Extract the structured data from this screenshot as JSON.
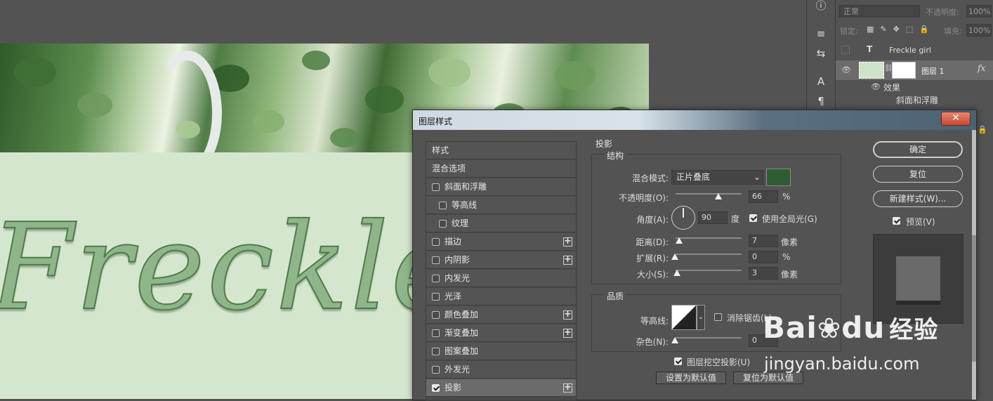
{
  "layers_panel": {
    "blend_mode": "正常",
    "opacity_label": "不透明度:",
    "opacity_value": "100%",
    "lock_label": "锁定:",
    "fill_label": "填充:",
    "fill_value": "100%",
    "layers": [
      {
        "name": "Freckle girl",
        "type": "text"
      },
      {
        "name": "图层 1",
        "type": "image",
        "fx": "fx"
      }
    ],
    "effects_label": "效果",
    "effect_items": [
      "斜面和浮雕"
    ]
  },
  "canvas": {
    "text": "Freckle g"
  },
  "dialog": {
    "title": "图层样式",
    "close": "✕",
    "style_list": [
      {
        "label": "样式",
        "checkbox": false,
        "checked": false,
        "plus": false,
        "indent": 0
      },
      {
        "label": "混合选项",
        "checkbox": false,
        "checked": false,
        "plus": false,
        "indent": 0
      },
      {
        "label": "斜面和浮雕",
        "checkbox": true,
        "checked": false,
        "plus": false,
        "indent": 0
      },
      {
        "label": "等高线",
        "checkbox": true,
        "checked": false,
        "plus": false,
        "indent": 1
      },
      {
        "label": "纹理",
        "checkbox": true,
        "checked": false,
        "plus": false,
        "indent": 1
      },
      {
        "label": "描边",
        "checkbox": true,
        "checked": false,
        "plus": true,
        "indent": 0
      },
      {
        "label": "内阴影",
        "checkbox": true,
        "checked": false,
        "plus": true,
        "indent": 0
      },
      {
        "label": "内发光",
        "checkbox": true,
        "checked": false,
        "plus": false,
        "indent": 0
      },
      {
        "label": "光泽",
        "checkbox": true,
        "checked": false,
        "plus": false,
        "indent": 0
      },
      {
        "label": "颜色叠加",
        "checkbox": true,
        "checked": false,
        "plus": true,
        "indent": 0
      },
      {
        "label": "渐变叠加",
        "checkbox": true,
        "checked": false,
        "plus": true,
        "indent": 0
      },
      {
        "label": "图案叠加",
        "checkbox": true,
        "checked": false,
        "plus": false,
        "indent": 0
      },
      {
        "label": "外发光",
        "checkbox": true,
        "checked": false,
        "plus": false,
        "indent": 0
      },
      {
        "label": "投影",
        "checkbox": true,
        "checked": true,
        "plus": true,
        "indent": 0,
        "selected": true
      }
    ],
    "section_title": "投影",
    "structure": {
      "title": "结构",
      "blend_mode_label": "混合模式:",
      "blend_mode_value": "正片叠底",
      "color": "#2e5d33",
      "opacity_label": "不透明度(O):",
      "opacity_value": "66",
      "opacity_unit": "%",
      "opacity_level": 66,
      "angle_label": "角度(A):",
      "angle_value": "90",
      "angle_unit": "度",
      "global_light_label": "使用全局光(G)",
      "global_light_checked": true,
      "distance_label": "距离(D):",
      "distance_value": "7",
      "distance_unit": "像素",
      "spread_label": "扩展(R):",
      "spread_value": "0",
      "spread_unit": "%",
      "size_label": "大小(S):",
      "size_value": "3",
      "size_unit": "像素"
    },
    "quality": {
      "title": "品质",
      "contour_label": "等高线:",
      "antialias_label": "消除锯齿(L)",
      "antialias_checked": false,
      "noise_label": "杂色(N):",
      "noise_value": "0"
    },
    "knockout_label": "图层挖空投影(U)",
    "knockout_checked": true,
    "set_default": "设置为默认值",
    "reset_default": "复位为默认值",
    "buttons": {
      "ok": "确定",
      "reset": "复位",
      "new_style": "新建样式(W)...",
      "preview_label": "预览(V)",
      "preview_checked": true
    }
  },
  "watermark": {
    "brand": "Bai",
    "brand_suffix": "du",
    "cn": "经验",
    "url": "jingyan.baidu.com"
  }
}
